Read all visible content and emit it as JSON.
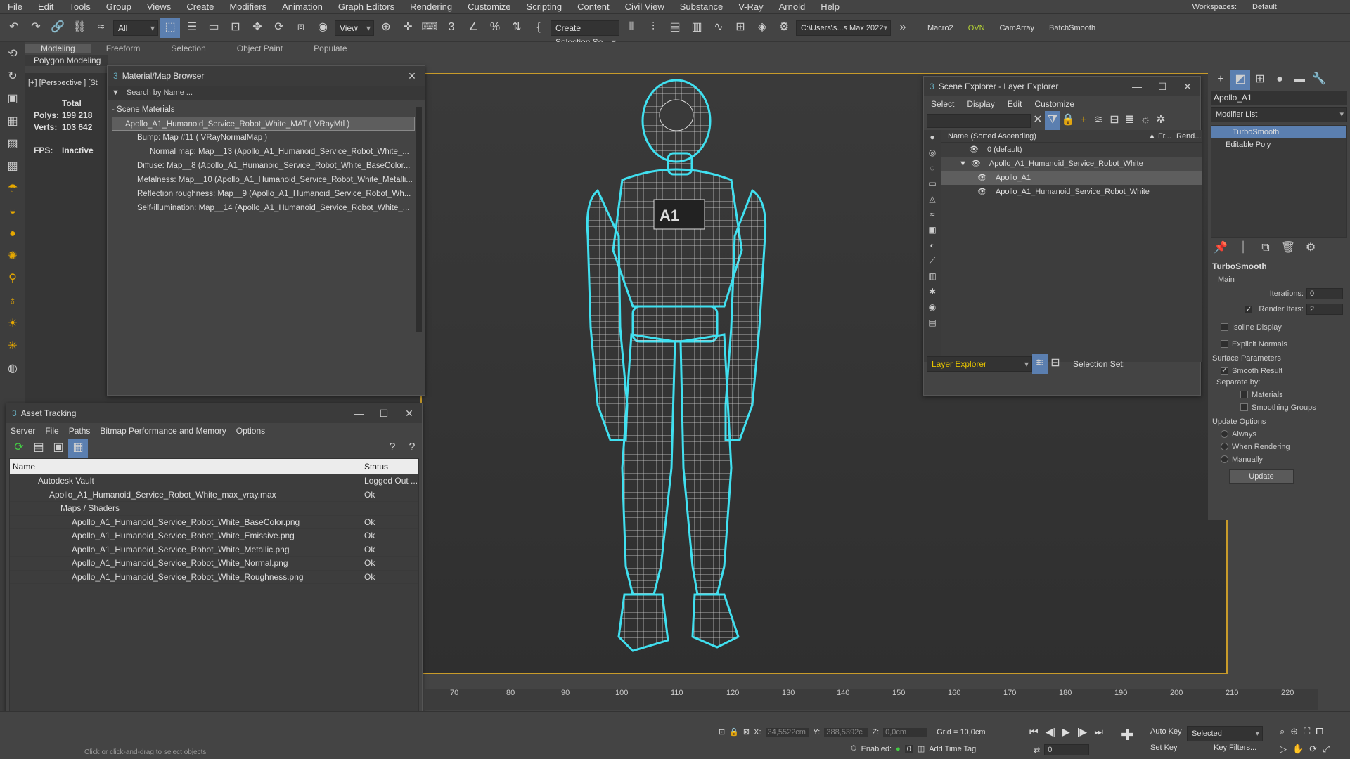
{
  "menu": [
    "File",
    "Edit",
    "Tools",
    "Group",
    "Views",
    "Create",
    "Modifiers",
    "Animation",
    "Graph Editors",
    "Rendering",
    "Customize",
    "Scripting",
    "Content",
    "Civil View",
    "Substance",
    "V-Ray",
    "Arnold",
    "Help"
  ],
  "workspace": {
    "label": "Workspaces:",
    "value": "Default"
  },
  "toolbar": {
    "filter": "All",
    "view": "View",
    "selection_set": "Create Selection Se",
    "path": "C:\\Users\\s...s Max 2022",
    "macros": [
      "Macro2",
      "OVN",
      "CamArray",
      "BatchSmooth"
    ]
  },
  "ribbon": {
    "tabs": [
      "Modeling",
      "Freeform",
      "Selection",
      "Object Paint",
      "Populate"
    ],
    "sub": "Polygon Modeling"
  },
  "viewport": {
    "label": "[+] [Perspective ] [St",
    "stats_total": "Total",
    "polys_label": "Polys:",
    "polys": "199 218",
    "verts_label": "Verts:",
    "verts": "103 642",
    "fps_label": "FPS:",
    "fps": "Inactive"
  },
  "material_browser": {
    "title": "Material/Map Browser",
    "search": "Search by Name ...",
    "section": "Scene Materials",
    "items": [
      "Apollo_A1_Humanoid_Service_Robot_White_MAT ( VRayMtl )",
      "Bump: Map #11  ( VRayNormalMap )",
      "Normal map: Map__13 (Apollo_A1_Humanoid_Service_Robot_White_...",
      "Diffuse: Map__8 (Apollo_A1_Humanoid_Service_Robot_White_BaseColor...",
      "Metalness: Map__10 (Apollo_A1_Humanoid_Service_Robot_White_Metalli...",
      "Reflection roughness: Map__9 (Apollo_A1_Humanoid_Service_Robot_Wh...",
      "Self-illumination: Map__14 (Apollo_A1_Humanoid_Service_Robot_White_..."
    ]
  },
  "asset_tracking": {
    "title": "Asset Tracking",
    "menu": [
      "Server",
      "File",
      "Paths",
      "Bitmap Performance and Memory",
      "Options"
    ],
    "col_name": "Name",
    "col_status": "Status",
    "rows": [
      {
        "name": "Autodesk Vault",
        "status": "Logged Out ..."
      },
      {
        "name": "Apollo_A1_Humanoid_Service_Robot_White_max_vray.max",
        "status": "Ok"
      },
      {
        "name": "Maps / Shaders",
        "status": ""
      },
      {
        "name": "Apollo_A1_Humanoid_Service_Robot_White_BaseColor.png",
        "status": "Ok"
      },
      {
        "name": "Apollo_A1_Humanoid_Service_Robot_White_Emissive.png",
        "status": "Ok"
      },
      {
        "name": "Apollo_A1_Humanoid_Service_Robot_White_Metallic.png",
        "status": "Ok"
      },
      {
        "name": "Apollo_A1_Humanoid_Service_Robot_White_Normal.png",
        "status": "Ok"
      },
      {
        "name": "Apollo_A1_Humanoid_Service_Robot_White_Roughness.png",
        "status": "Ok"
      }
    ]
  },
  "scene_explorer": {
    "title": "Scene Explorer - Layer Explorer",
    "menu": [
      "Select",
      "Display",
      "Edit",
      "Customize"
    ],
    "col_name": "Name (Sorted Ascending)",
    "col_fr": "▲ Fr...",
    "col_rend": "Rend...",
    "rows": [
      "0 (default)",
      "Apollo_A1_Humanoid_Service_Robot_White",
      "Apollo_A1",
      "Apollo_A1_Humanoid_Service_Robot_White"
    ],
    "footer_dd": "Layer Explorer",
    "selection_set": "Selection Set:"
  },
  "command_panel": {
    "object": "Apollo_A1",
    "modifier_list": "Modifier List",
    "stack": [
      "TurboSmooth",
      "Editable Poly"
    ],
    "ts_title": "TurboSmooth",
    "main": "Main",
    "iterations_label": "Iterations:",
    "iterations": "0",
    "render_iters_label": "Render Iters:",
    "render_iters": "2",
    "isoline": "Isoline Display",
    "explicit": "Explicit Normals",
    "surface": "Surface Parameters",
    "smooth": "Smooth Result",
    "separate": "Separate by:",
    "materials": "Materials",
    "smoothing": "Smoothing Groups",
    "update_opts": "Update Options",
    "always": "Always",
    "when_rendering": "When Rendering",
    "manually": "Manually",
    "update": "Update"
  },
  "timeline": {
    "ticks": [
      "70",
      "80",
      "90",
      "100",
      "110",
      "120",
      "130",
      "140",
      "150",
      "160",
      "170",
      "180",
      "190",
      "200",
      "210",
      "220"
    ]
  },
  "status": {
    "x_label": "X:",
    "x": "34,5522cm",
    "y_label": "Y:",
    "y": "388,5392c",
    "z_label": "Z:",
    "z": "0,0cm",
    "grid": "Grid = 10,0cm",
    "enabled": "Enabled:",
    "add_time_tag": "Add Time Tag",
    "auto_key": "Auto Key",
    "selected": "Selected",
    "set_key": "Set Key",
    "key_filters": "Key Filters...",
    "frame": "0",
    "hint": "Click or click-and-drag to select objects"
  }
}
